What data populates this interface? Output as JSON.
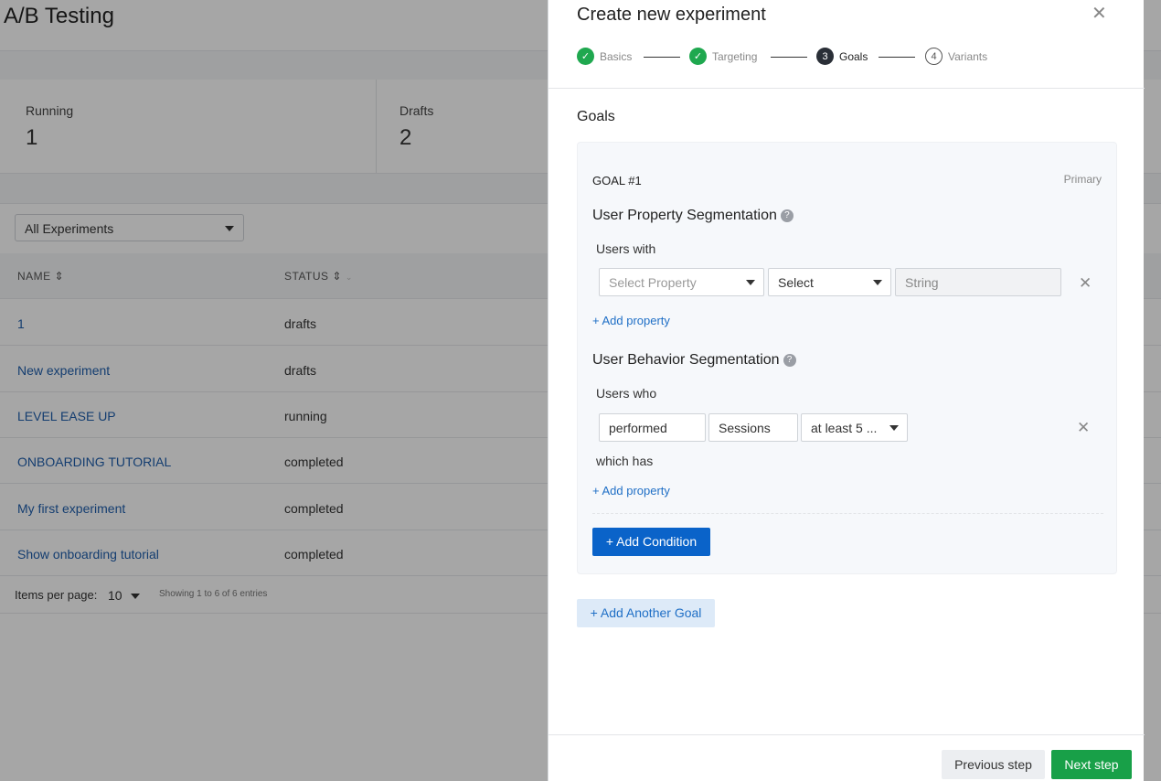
{
  "background": {
    "title": "A/B Testing",
    "stats": [
      {
        "label": "Running",
        "value": "1"
      },
      {
        "label": "Drafts",
        "value": "2"
      }
    ],
    "filter": {
      "value": "All Experiments"
    },
    "table": {
      "columns": [
        "NAME",
        "STATUS"
      ],
      "rows": [
        {
          "name": "1",
          "status": "drafts"
        },
        {
          "name": "New experiment",
          "status": "drafts"
        },
        {
          "name": "LEVEL EASE UP",
          "status": "running"
        },
        {
          "name": "ONBOARDING TUTORIAL",
          "status": "completed"
        },
        {
          "name": "My first experiment",
          "status": "completed"
        },
        {
          "name": "Show onboarding tutorial",
          "status": "completed"
        }
      ]
    },
    "pager": {
      "label": "Items per page:",
      "value": "10",
      "info": "Showing 1 to 6 of 6 entries"
    }
  },
  "drawer": {
    "title": "Create new experiment",
    "steps": [
      {
        "num": "1",
        "label": "Basics",
        "state": "done"
      },
      {
        "num": "2",
        "label": "Targeting",
        "state": "done"
      },
      {
        "num": "3",
        "label": "Goals",
        "state": "active"
      },
      {
        "num": "4",
        "label": "Variants",
        "state": "todo"
      }
    ],
    "section_title": "Goals",
    "goal": {
      "number": "GOAL #1",
      "badge": "Primary",
      "property_seg": {
        "title": "User Property Segmentation",
        "users_label": "Users with",
        "property_placeholder": "Select Property",
        "operator": "Select",
        "value_placeholder": "String",
        "add_property": "+ Add property"
      },
      "behavior_seg": {
        "title": "User Behavior Segmentation",
        "users_label": "Users who",
        "action": "performed",
        "event": "Sessions",
        "frequency": "at least 5 ...",
        "which_has": "which has",
        "add_property": "+ Add property"
      },
      "add_condition": "+ Add Condition"
    },
    "add_goal": "+ Add Another Goal",
    "footer": {
      "previous": "Previous step",
      "next": "Next step"
    }
  },
  "colors": {
    "primary": "#0a63c9",
    "success": "#18a048",
    "link": "#1f6fc6"
  }
}
